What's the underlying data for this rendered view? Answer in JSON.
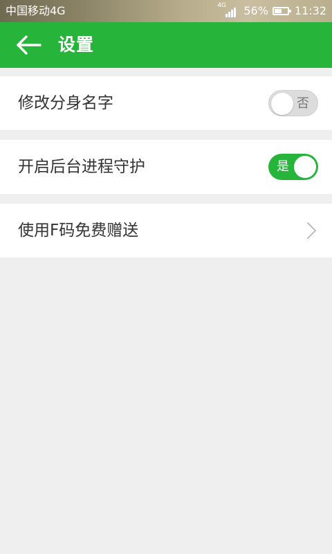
{
  "status_bar": {
    "carrier": "中国移动4G",
    "network_label": "4G",
    "signal_icon": "signal-bars-icon",
    "battery_percent": "56%",
    "battery_level": 0.56,
    "time": "11:32"
  },
  "header": {
    "back_icon": "arrow-left-icon",
    "title": "设置",
    "background_color": "#27b43b"
  },
  "settings": [
    {
      "label": "修改分身名字",
      "control": "toggle",
      "state": "off",
      "toggle_text": "否"
    },
    {
      "label": "开启后台进程守护",
      "control": "toggle",
      "state": "on",
      "toggle_text": "是"
    },
    {
      "label": "使用F码免费赠送",
      "control": "chevron",
      "icon": "chevron-right-icon"
    }
  ],
  "colors": {
    "accent": "#27b43b",
    "toggle_off": "#dcdcdc",
    "page_background": "#efefef"
  }
}
